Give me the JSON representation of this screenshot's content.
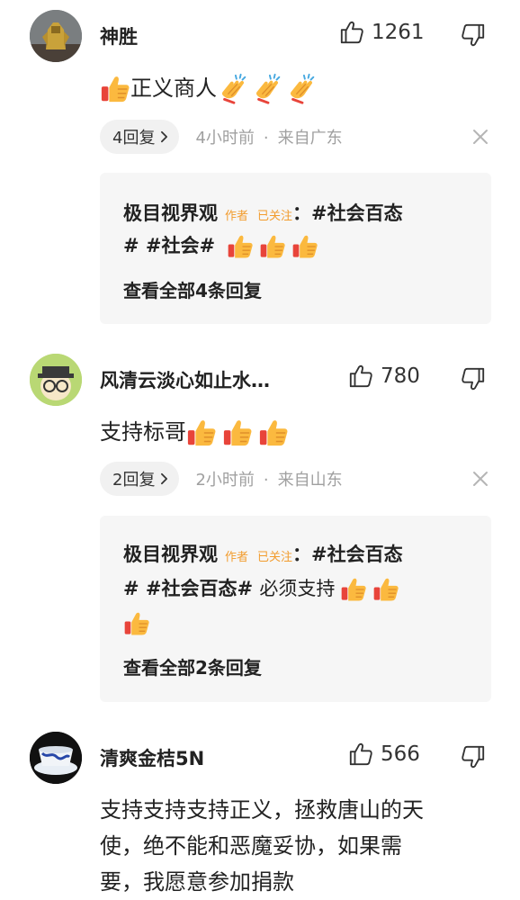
{
  "comments": [
    {
      "username": "神胜",
      "likes": "1261",
      "text": "正义商人",
      "reply_pill": "4回复",
      "time": "4小时前",
      "location": "来自广东",
      "reply": {
        "author": "极目视界观",
        "author_tag": "作者",
        "followed_tag": "已关注",
        "line1_text": "：#社会百态",
        "line2_text": "# #社会#",
        "view_all": "查看全部4条回复"
      }
    },
    {
      "username": "风清云淡心如止水…",
      "likes": "780",
      "text": "支持标哥",
      "reply_pill": "2回复",
      "time": "2小时前",
      "location": "来自山东",
      "reply": {
        "author": "极目视界观",
        "author_tag": "作者",
        "followed_tag": "已关注",
        "line1_text": "：#社会百态",
        "line2_text": "# #社会百态#",
        "line2_plain": "必须支持",
        "view_all": "查看全部2条回复"
      }
    },
    {
      "username": "清爽金桔5N",
      "likes": "566",
      "text_lines": [
        "支持支持支持正义，拯救唐山的天",
        "使，绝不能和恶魔妥协，如果需",
        "要，我愿意参加捐款"
      ]
    }
  ],
  "separator": "·",
  "colors": {
    "tag": "#f29c2e",
    "meta": "#a0a0a0",
    "reply_bg": "#f6f6f6",
    "pill_bg": "#f1f1f1"
  },
  "icons": [
    "thumbs-up-icon",
    "thumbs-down-icon",
    "close-icon",
    "chevron-right-icon",
    "thumbs-up-emoji",
    "clapping-emoji"
  ]
}
